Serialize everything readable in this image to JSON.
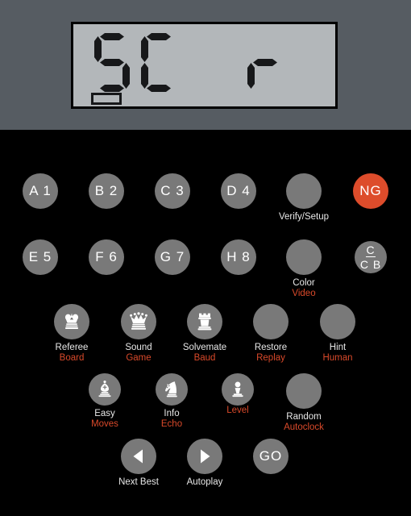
{
  "device": {
    "name": "chess-computer-keypad",
    "panel_color": "#565c62",
    "body_color": "#000000",
    "button_color": "#797979",
    "accent_color": "#dd4c2b",
    "label_white": "#e8e8e8",
    "label_orange": "#d9492a"
  },
  "lcd": {
    "background": "#b3b7ba",
    "segment_color": "#17181a",
    "text": "5C  r",
    "characters": [
      {
        "char": "5",
        "segments": [
          "a",
          "f",
          "g",
          "c",
          "d"
        ]
      },
      {
        "char": "C",
        "segments": [
          "a",
          "f",
          "e",
          "d"
        ]
      },
      {
        "char": " ",
        "segments": []
      },
      {
        "char": "r",
        "segments": [
          "e",
          "g"
        ]
      }
    ],
    "indicator": {
      "name": "battery-indicator",
      "filled": false
    }
  },
  "keypad": {
    "rows": [
      {
        "name": "row-square-abcd",
        "keys": [
          {
            "name": "key-a1",
            "face": "A 1",
            "style": "text"
          },
          {
            "name": "key-b2",
            "face": "B 2",
            "style": "text"
          },
          {
            "name": "key-c3",
            "face": "C 3",
            "style": "text"
          },
          {
            "name": "key-d4",
            "face": "D 4",
            "style": "text"
          },
          {
            "name": "key-verify-setup",
            "face": "",
            "style": "blank",
            "label_white": "Verify/Setup"
          },
          {
            "name": "key-new-game",
            "face": "NG",
            "style": "accent"
          }
        ]
      },
      {
        "name": "row-square-efgh",
        "keys": [
          {
            "name": "key-e5",
            "face": "E 5",
            "style": "text"
          },
          {
            "name": "key-f6",
            "face": "F 6",
            "style": "text"
          },
          {
            "name": "key-g7",
            "face": "G 7",
            "style": "text"
          },
          {
            "name": "key-h8",
            "face": "H 8",
            "style": "text"
          },
          {
            "name": "key-color-video",
            "face": "",
            "style": "blank",
            "label_white": "Color",
            "label_orange": "Video"
          },
          {
            "name": "key-contrast",
            "face": "C / C B",
            "style": "fraction",
            "numerator": "C",
            "denominator": "C B"
          }
        ]
      },
      {
        "name": "row-function-1",
        "keys": [
          {
            "name": "key-referee-board",
            "icon": "chess-king-icon",
            "style": "icon",
            "label_white": "Referee",
            "label_orange": "Board"
          },
          {
            "name": "key-sound-game",
            "icon": "chess-queen-icon",
            "style": "icon",
            "label_white": "Sound",
            "label_orange": "Game"
          },
          {
            "name": "key-solvemate-baud",
            "icon": "chess-rook-icon",
            "style": "icon",
            "label_white": "Solvemate",
            "label_orange": "Baud"
          },
          {
            "name": "key-restore-replay",
            "face": "",
            "style": "blank",
            "label_white": "Restore",
            "label_orange": "Replay"
          },
          {
            "name": "key-hint-human",
            "face": "",
            "style": "blank",
            "label_white": "Hint",
            "label_orange": "Human"
          }
        ]
      },
      {
        "name": "row-function-2",
        "keys": [
          {
            "name": "key-easy-moves",
            "icon": "chess-bishop-icon",
            "style": "icon",
            "label_white": "Easy",
            "label_orange": "Moves"
          },
          {
            "name": "key-info-echo",
            "icon": "chess-knight-icon",
            "style": "icon",
            "label_white": "Info",
            "label_orange": "Echo"
          },
          {
            "name": "key-level",
            "icon": "chess-pawn-icon",
            "style": "icon",
            "label_orange": "Level"
          },
          {
            "name": "key-random-autoclock",
            "face": "",
            "style": "blank",
            "label_white": "Random",
            "label_orange": "Autoclock"
          }
        ]
      },
      {
        "name": "row-transport",
        "keys": [
          {
            "name": "key-next-best",
            "icon": "triangle-left-icon",
            "style": "icon",
            "label_white": "Next Best"
          },
          {
            "name": "key-autoplay",
            "icon": "triangle-right-icon",
            "style": "icon",
            "label_white": "Autoplay"
          },
          {
            "name": "key-go",
            "face": "GO",
            "style": "text"
          }
        ]
      }
    ]
  }
}
